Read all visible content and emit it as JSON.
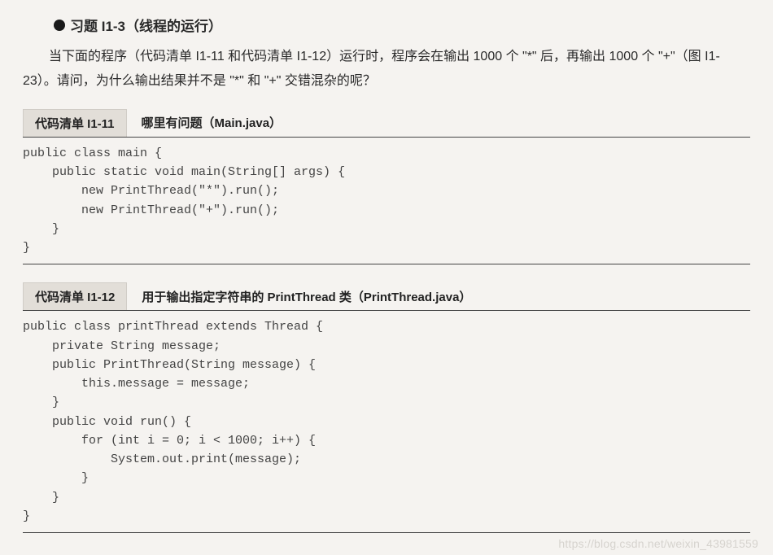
{
  "title": {
    "label": "习题 I1-3（线程的运行）"
  },
  "description": "当下面的程序（代码清单 I1-11 和代码清单 I1-12）运行时，程序会在输出 1000 个 \"*\" 后，再输出 1000 个 \"+\"（图 I1-23）。请问，为什么输出结果并不是 \"*\" 和 \"+\" 交错混杂的呢？",
  "listing1": {
    "label": "代码清单 I1-11",
    "title": "哪里有问题（Main.java）",
    "code": "public class main {\n    public static void main(String[] args) {\n        new PrintThread(\"*\").run();\n        new PrintThread(\"+\").run();\n    }\n}"
  },
  "listing2": {
    "label": "代码清单 I1-12",
    "title": "用于输出指定字符串的 PrintThread 类（PrintThread.java）",
    "code": "public class printThread extends Thread {\n    private String message;\n    public PrintThread(String message) {\n        this.message = message;\n    }\n    public void run() {\n        for (int i = 0; i < 1000; i++) {\n            System.out.print(message);\n        }\n    }\n}"
  },
  "watermark": "https://blog.csdn.net/weixin_43981559"
}
